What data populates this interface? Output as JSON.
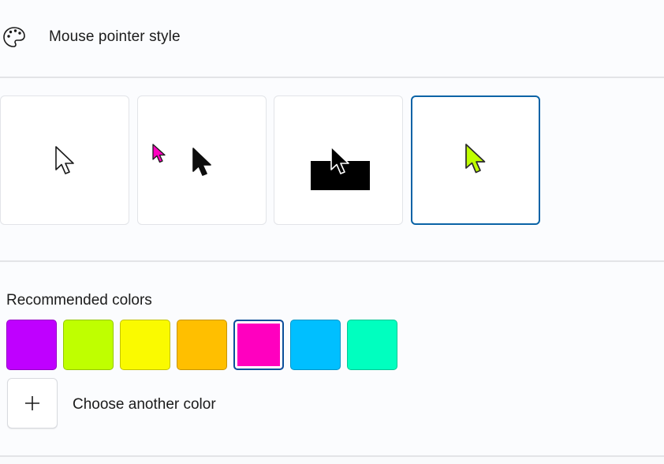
{
  "header": {
    "title": "Mouse pointer style",
    "icon": "palette-icon"
  },
  "pointer_styles": [
    {
      "name": "white",
      "icon": "pointer-white-icon",
      "selected": false
    },
    {
      "name": "black",
      "icon": "pointer-black-icon",
      "selected": false
    },
    {
      "name": "inverted",
      "icon": "pointer-inverted-icon",
      "selected": false
    },
    {
      "name": "custom",
      "icon": "pointer-custom-icon",
      "selected": true
    }
  ],
  "recommended": {
    "label": "Recommended colors",
    "colors": [
      {
        "hex": "#BF00FF",
        "selected": false
      },
      {
        "hex": "#BFFF00",
        "selected": false
      },
      {
        "hex": "#FAFA00",
        "selected": false
      },
      {
        "hex": "#FFBF00",
        "selected": false
      },
      {
        "hex": "#FF00BF",
        "selected": true
      },
      {
        "hex": "#00BFFF",
        "selected": false
      },
      {
        "hex": "#00FFBF",
        "selected": false
      }
    ]
  },
  "choose_color": {
    "label": "Choose another color",
    "icon": "plus-icon"
  },
  "colors": {
    "accent": "#0A63A6",
    "custom_pointer": "#BFFF00",
    "pink_pointer": "#FF00BF"
  }
}
